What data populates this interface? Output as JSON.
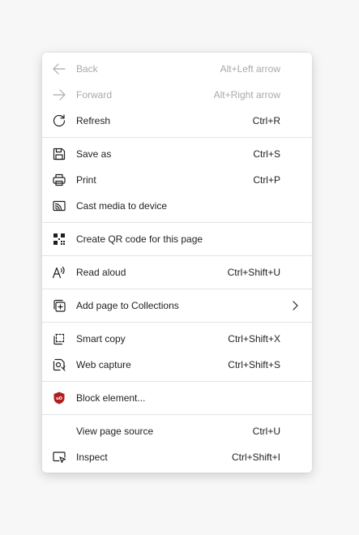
{
  "menu": {
    "back": {
      "label": "Back",
      "shortcut": "Alt+Left arrow",
      "icon": "arrow-left-icon"
    },
    "forward": {
      "label": "Forward",
      "shortcut": "Alt+Right arrow",
      "icon": "arrow-right-icon"
    },
    "refresh": {
      "label": "Refresh",
      "shortcut": "Ctrl+R",
      "icon": "refresh-icon"
    },
    "save_as": {
      "label": "Save as",
      "shortcut": "Ctrl+S",
      "icon": "save-icon"
    },
    "print": {
      "label": "Print",
      "shortcut": "Ctrl+P",
      "icon": "printer-icon"
    },
    "cast": {
      "label": "Cast media to device",
      "icon": "cast-icon"
    },
    "qr": {
      "label": "Create QR code for this page",
      "icon": "qr-code-icon"
    },
    "read_aloud": {
      "label": "Read aloud",
      "shortcut": "Ctrl+Shift+U",
      "icon": "read-aloud-icon"
    },
    "collections": {
      "label": "Add page to Collections",
      "icon": "collections-icon"
    },
    "smart_copy": {
      "label": "Smart copy",
      "shortcut": "Ctrl+Shift+X",
      "icon": "smart-copy-icon"
    },
    "web_capture": {
      "label": "Web capture",
      "shortcut": "Ctrl+Shift+S",
      "icon": "web-capture-icon"
    },
    "block_element": {
      "label": "Block element...",
      "icon": "ublock-shield-icon"
    },
    "view_source": {
      "label": "View page source",
      "shortcut": "Ctrl+U"
    },
    "inspect": {
      "label": "Inspect",
      "shortcut": "Ctrl+Shift+I",
      "icon": "inspect-icon"
    }
  },
  "colors": {
    "text": "#1f1f1f",
    "disabled_text": "#a9a9a9",
    "separator": "#e3e3e3",
    "ublock_red": "#b21d1d"
  }
}
